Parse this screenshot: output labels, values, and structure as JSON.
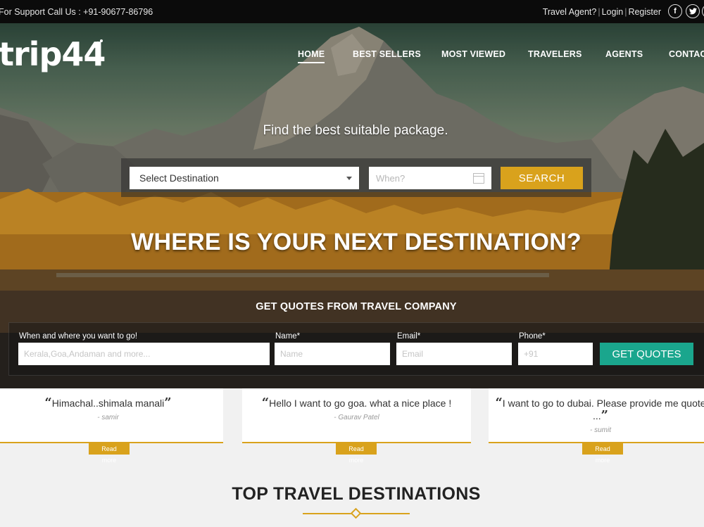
{
  "topbar": {
    "support": "For Support Call Us : +91-90677-86796",
    "travel_agent": "Travel Agent?",
    "login": "Login",
    "register": "Register",
    "social_icons": [
      "facebook-icon",
      "twitter-icon"
    ]
  },
  "logo": {
    "text": "trip44"
  },
  "nav": {
    "items": [
      "HOME",
      "BEST SELLERS",
      "MOST VIEWED",
      "TRAVELERS",
      "AGENTS",
      "CONTACT"
    ],
    "active": "HOME"
  },
  "search": {
    "title": "Find the best suitable package.",
    "destination": "Select Destination",
    "when_placeholder": "When?",
    "button": "SEARCH"
  },
  "hero": {
    "heading": "WHERE IS YOUR NEXT DESTINATION?"
  },
  "quotes": {
    "heading": "GET QUOTES FROM TRAVEL COMPANY",
    "labels": {
      "where": "When and where you want to go!",
      "name": "Name*",
      "email": "Email*",
      "phone": "Phone*"
    },
    "placeholders": {
      "where": "Kerala,Goa,Andaman and more...",
      "name": "Name",
      "email": "Email",
      "phone": "+91"
    },
    "button": "GET QUOTES"
  },
  "testimonials": [
    {
      "quote": "Himachal..shimala manali",
      "author": "- samir",
      "link": "Read more"
    },
    {
      "quote": "Hello I want to go goa. what a nice place !",
      "author": "- Gaurav Patel",
      "link": "Read more"
    },
    {
      "quote": "I want to go to dubai. Please provide me quote ...",
      "author": "- sumit",
      "link": "Read more"
    }
  ],
  "destinations": {
    "title": "TOP TRAVEL DESTINATIONS"
  },
  "colors": {
    "accent": "#d9a21c",
    "quotes_button": "#1aa68d",
    "topbar": "#0b0b0b"
  }
}
